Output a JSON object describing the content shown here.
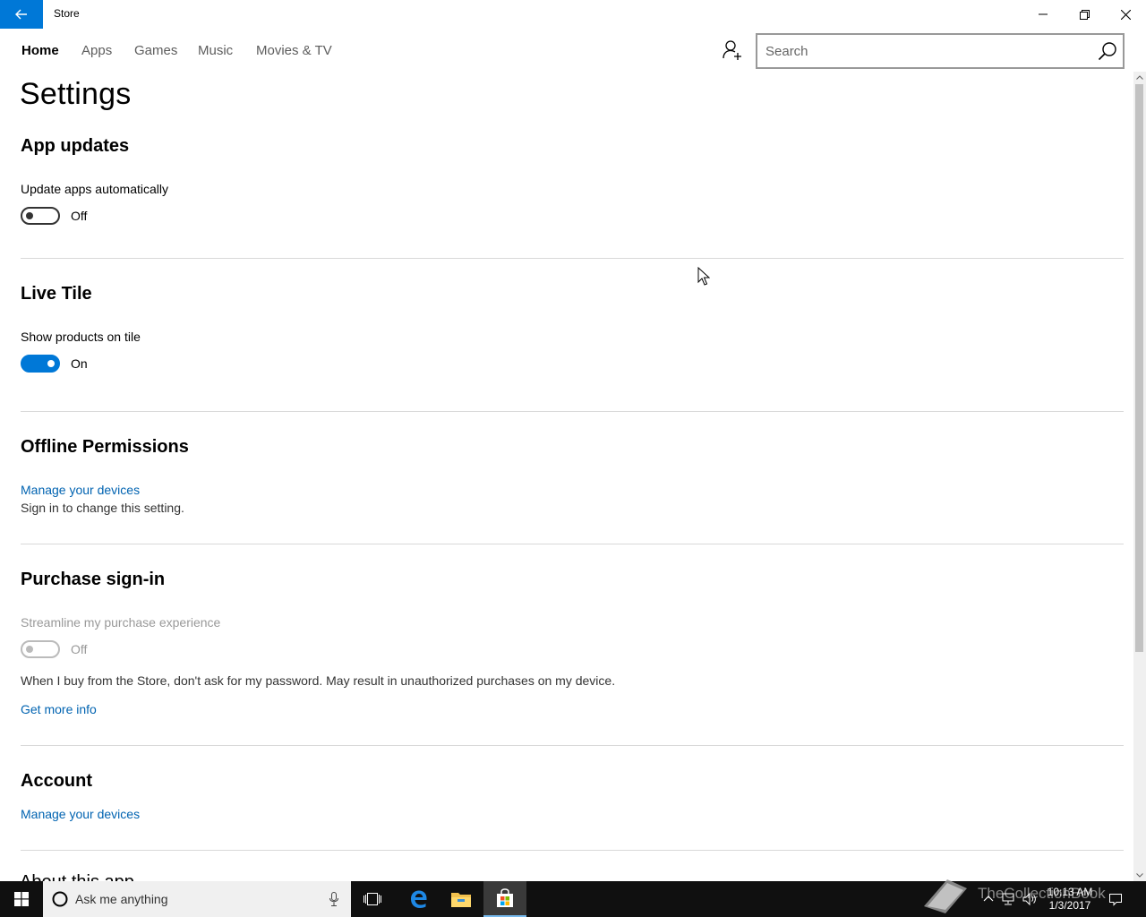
{
  "window": {
    "title": "Store",
    "controls": [
      "minimize-icon",
      "restore-icon",
      "close-icon"
    ],
    "accent": "#0078d7"
  },
  "nav": {
    "items": [
      {
        "label": "Home",
        "active": true
      },
      {
        "label": "Apps",
        "active": false
      },
      {
        "label": "Games",
        "active": false
      },
      {
        "label": "Music",
        "active": false
      },
      {
        "label": "Movies & TV",
        "active": false
      }
    ],
    "search_placeholder": "Search"
  },
  "page": {
    "title": "Settings",
    "sections": {
      "app_updates": {
        "title": "App updates",
        "setting_label": "Update apps automatically",
        "toggle_state": "Off",
        "toggle_on": false
      },
      "live_tile": {
        "title": "Live Tile",
        "setting_label": "Show products on tile",
        "toggle_state": "On",
        "toggle_on": true
      },
      "offline_permissions": {
        "title": "Offline Permissions",
        "link": "Manage your devices",
        "note": "Sign in to change this setting."
      },
      "purchase_signin": {
        "title": "Purchase sign-in",
        "setting_label": "Streamline my purchase experience",
        "toggle_state": "Off",
        "toggle_on": false,
        "disabled": true,
        "description": "When I buy from the Store, don't ask for my password. May result in unauthorized purchases on my device.",
        "link": "Get more info"
      },
      "account": {
        "title": "Account",
        "link": "Manage your devices"
      },
      "about": {
        "title_partial": "About this app"
      }
    }
  },
  "taskbar": {
    "search_placeholder": "Ask me anything",
    "pinned": [
      "task-view-icon",
      "edge-icon",
      "file-explorer-icon",
      "store-icon"
    ],
    "active_app": "store-icon",
    "tray": [
      "chevron-up-icon",
      "network-icon",
      "volume-icon",
      "action-center-icon"
    ],
    "time": "10:13 AM",
    "date": "1/3/2017"
  },
  "watermark": {
    "text": "TheCollectionBook"
  }
}
